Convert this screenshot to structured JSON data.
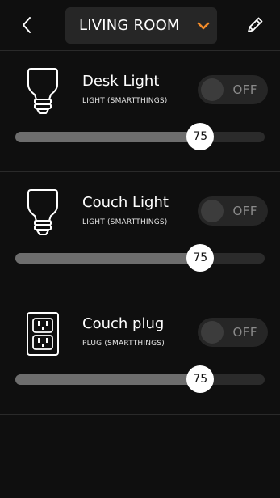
{
  "header": {
    "room_name": "LIVING ROOM",
    "back_icon": "chevron-left-icon",
    "dropdown_icon": "chevron-down-icon",
    "edit_icon": "pencil-icon",
    "accent_color": "#f28b2a"
  },
  "devices": [
    {
      "name": "Desk Light",
      "type": "LIGHT (SMARTTHINGS)",
      "icon": "light-bulb-icon",
      "toggle_label": "OFF",
      "level": 75,
      "level_label": "75"
    },
    {
      "name": "Couch Light",
      "type": "LIGHT (SMARTTHINGS)",
      "icon": "light-bulb-icon",
      "toggle_label": "OFF",
      "level": 75,
      "level_label": "75"
    },
    {
      "name": "Couch plug",
      "type": "PLUG (SMARTTHINGS)",
      "icon": "power-outlet-icon",
      "toggle_label": "OFF",
      "level": 75,
      "level_label": "75"
    }
  ]
}
